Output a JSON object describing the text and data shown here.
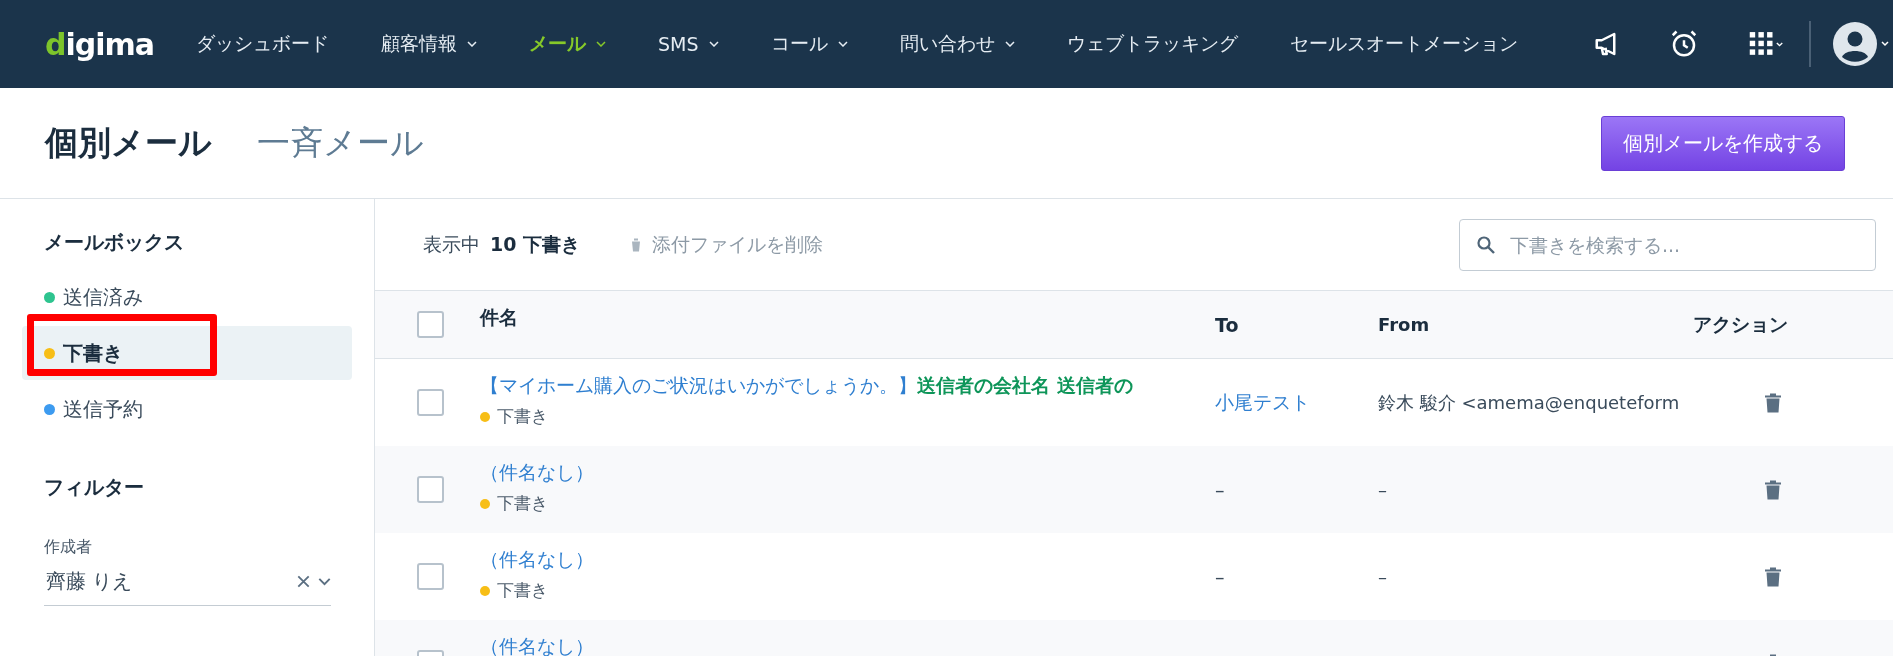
{
  "nav": {
    "logo": "digima",
    "items": [
      {
        "label": "ダッシュボード",
        "dropdown": false,
        "selected": false
      },
      {
        "label": "顧客情報",
        "dropdown": true,
        "selected": false
      },
      {
        "label": "メール",
        "dropdown": true,
        "selected": true
      },
      {
        "label": "SMS",
        "dropdown": true,
        "selected": false
      },
      {
        "label": "コール",
        "dropdown": true,
        "selected": false
      },
      {
        "label": "問い合わせ",
        "dropdown": true,
        "selected": false
      },
      {
        "label": "ウェブトラッキング",
        "dropdown": false,
        "selected": false
      },
      {
        "label": "セールスオートメーション",
        "dropdown": false,
        "selected": false
      }
    ]
  },
  "tabs": [
    {
      "label": "個別メール",
      "selected": true
    },
    {
      "label": "一斉メール",
      "selected": false
    }
  ],
  "create_button": "個別メールを作成する",
  "sidebar": {
    "mailbox_title": "メールボックス",
    "mailboxes": [
      {
        "label": "送信済み",
        "color": "#2ec48f",
        "selected": false,
        "annotated": false
      },
      {
        "label": "下書き",
        "color": "#f7be16",
        "selected": true,
        "annotated": true
      },
      {
        "label": "送信予約",
        "color": "#3d9bf0",
        "selected": false,
        "annotated": false
      }
    ],
    "filter_title": "フィルター",
    "filter": {
      "label": "作成者",
      "value": "齊藤 りえ"
    }
  },
  "toolbar": {
    "showing": "表示中",
    "count": "10 下書き",
    "delete_attachments": "添付ファイルを削除",
    "search": {
      "placeholder": "下書きを検索する..."
    }
  },
  "table": {
    "columns": [
      "件名",
      "To",
      "From",
      "アクション"
    ],
    "header_checked": false,
    "rows": [
      {
        "checked": false,
        "subject": "【マイホーム購入のご状況はいかがでしょうか。】",
        "subject_tag": "送信者の会社名 送信者の",
        "status": "下書き",
        "to": "小尾テスト",
        "to_link": true,
        "from": "鈴木 駿介 <amema@enqueteform"
      },
      {
        "checked": false,
        "subject": "（件名なし）",
        "status": "下書き",
        "to": "–",
        "to_link": false,
        "from": "–"
      },
      {
        "checked": false,
        "subject": "（件名なし）",
        "status": "下書き",
        "to": "–",
        "to_link": false,
        "from": "–"
      },
      {
        "checked": false,
        "subject": "（件名なし）"
      }
    ]
  }
}
